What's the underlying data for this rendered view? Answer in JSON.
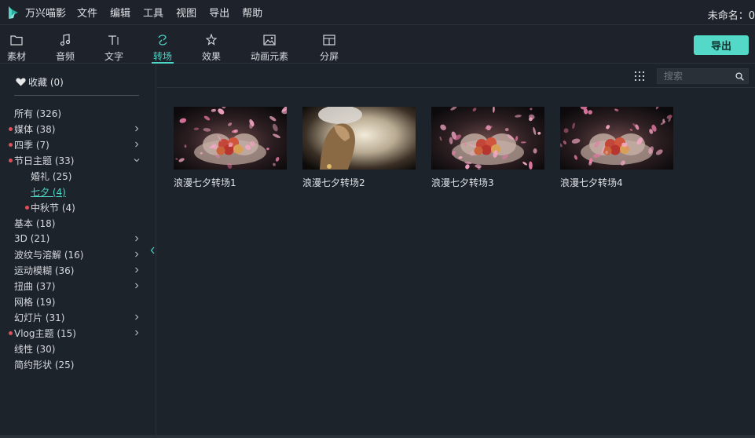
{
  "app": {
    "name": "万兴喵影",
    "menu": [
      "文件",
      "编辑",
      "工具",
      "视图",
      "导出",
      "帮助"
    ],
    "project_name": "未命名：0"
  },
  "toolbar": {
    "tabs": [
      {
        "label": "素材",
        "icon": "folder-icon"
      },
      {
        "label": "音频",
        "icon": "music-note-icon"
      },
      {
        "label": "文字",
        "icon": "text-icon"
      },
      {
        "label": "转场",
        "icon": "transition-icon",
        "active": true
      },
      {
        "label": "效果",
        "icon": "effects-icon"
      },
      {
        "label": "动画元素",
        "icon": "image-icon"
      },
      {
        "label": "分屏",
        "icon": "split-screen-icon"
      }
    ],
    "export_label": "导出"
  },
  "sidebar": {
    "favorites": "收藏 (0)",
    "categories": [
      {
        "label": "所有 (326)",
        "dot": false,
        "chevron": ""
      },
      {
        "label": "媒体 (38)",
        "dot": true,
        "chevron": "right"
      },
      {
        "label": "四季 (7)",
        "dot": true,
        "chevron": "right"
      },
      {
        "label": "节日主题 (33)",
        "dot": true,
        "chevron": "down"
      },
      {
        "label": "婚礼 (25)",
        "dot": false,
        "chevron": "",
        "sub": true
      },
      {
        "label": "七夕 (4)",
        "dot": false,
        "chevron": "",
        "sub": true,
        "selected": true
      },
      {
        "label": "中秋节 (4)",
        "dot": true,
        "chevron": "",
        "sub": true
      },
      {
        "label": "基本 (18)",
        "dot": false,
        "chevron": ""
      },
      {
        "label": "3D (21)",
        "dot": false,
        "chevron": "right"
      },
      {
        "label": "波纹与溶解 (16)",
        "dot": false,
        "chevron": "right"
      },
      {
        "label": "运动模糊 (36)",
        "dot": false,
        "chevron": "right"
      },
      {
        "label": "扭曲 (37)",
        "dot": false,
        "chevron": "right"
      },
      {
        "label": "网格 (19)",
        "dot": false,
        "chevron": ""
      },
      {
        "label": "幻灯片 (31)",
        "dot": false,
        "chevron": "right"
      },
      {
        "label": "Vlog主题 (15)",
        "dot": true,
        "chevron": "right"
      },
      {
        "label": "线性 (30)",
        "dot": false,
        "chevron": ""
      },
      {
        "label": "简约形状 (25)",
        "dot": false,
        "chevron": ""
      }
    ]
  },
  "search": {
    "placeholder": "搜索"
  },
  "items": [
    {
      "label": "浪漫七夕转场1",
      "thumb": "petals"
    },
    {
      "label": "浪漫七夕转场2",
      "thumb": "girl"
    },
    {
      "label": "浪漫七夕转场3",
      "thumb": "petals"
    },
    {
      "label": "浪漫七夕转场4",
      "thumb": "petals"
    }
  ],
  "colors": {
    "accent": "#4fd6c7",
    "export_button": "#54d9c9",
    "new_dot": "#e0505a",
    "background": "#1d232b"
  }
}
